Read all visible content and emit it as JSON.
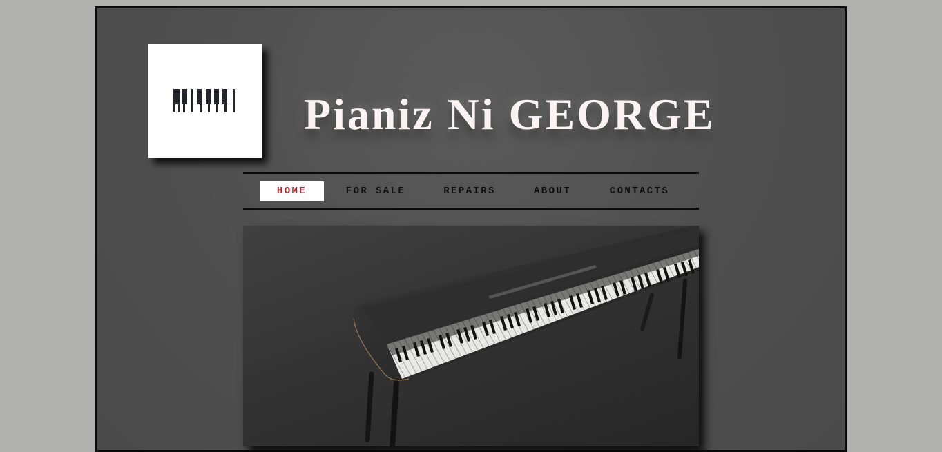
{
  "site": {
    "title": "Pianiz Ni GEORGE",
    "logo_icon": "piano-keys-icon"
  },
  "nav": {
    "items": [
      {
        "label": "HOME",
        "active": true
      },
      {
        "label": "FOR SALE",
        "active": false
      },
      {
        "label": "REPAIRS",
        "active": false
      },
      {
        "label": "ABOUT",
        "active": false
      },
      {
        "label": "CONTACTS",
        "active": false
      }
    ],
    "active_color": "#c0202a"
  },
  "hero": {
    "image": "digital-piano-photo"
  },
  "colors": {
    "page_background": "#b0b0ae",
    "frame_background": "#4f4f4f",
    "title_text": "#fbf3f3"
  }
}
